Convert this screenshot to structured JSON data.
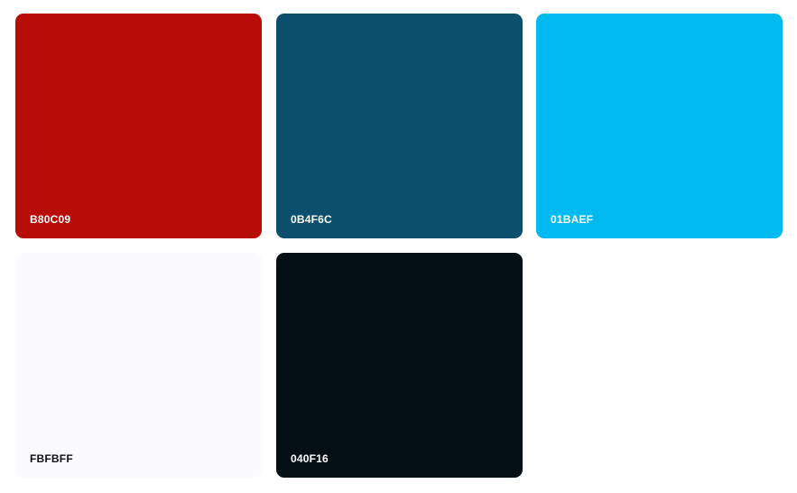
{
  "swatches": [
    {
      "hex": "B80C09",
      "color": "#B80C09",
      "text_color": "#FFFFFF"
    },
    {
      "hex": "0B4F6C",
      "color": "#0B4F6C",
      "text_color": "#FFFFFF"
    },
    {
      "hex": "01BAEF",
      "color": "#01BAEF",
      "text_color": "#FFFFFF"
    },
    {
      "hex": "FBFBFF",
      "color": "#FBFBFF",
      "text_color": "#111111"
    },
    {
      "hex": "040F16",
      "color": "#040F16",
      "text_color": "#FFFFFF"
    }
  ]
}
